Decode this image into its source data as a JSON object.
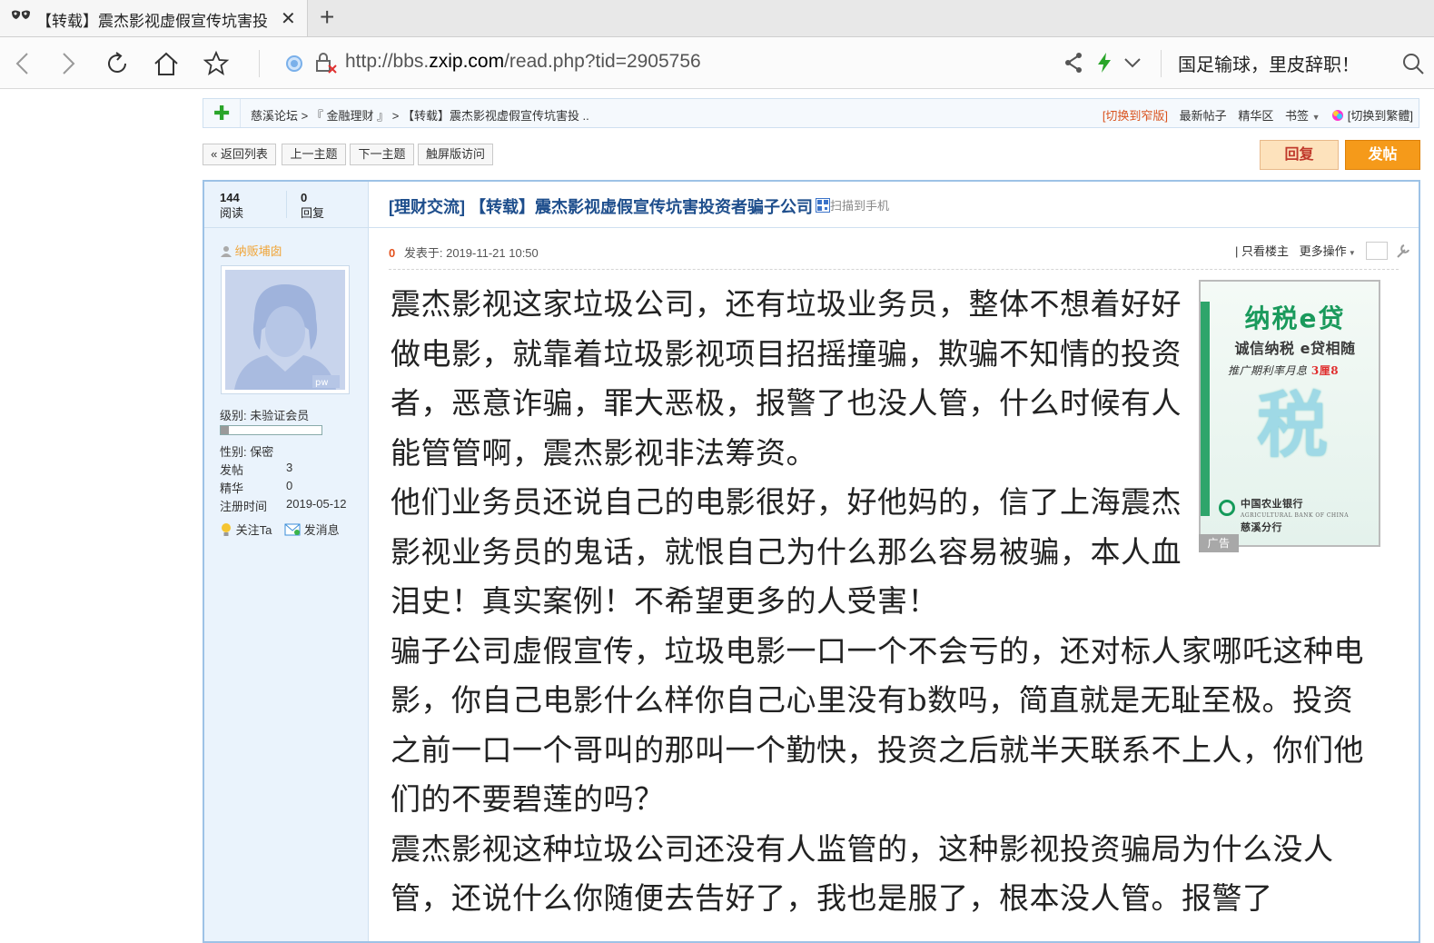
{
  "browser": {
    "tab_title": "【转载】震杰影视虚假宣传坑害投",
    "url_prefix": "http://bbs.",
    "url_domain": "zxip.com",
    "url_path": "/read.php?tid=2905756",
    "news_ticker": "国足输球，里皮辞职！"
  },
  "breadcrumb": {
    "forum": "慈溪论坛",
    "section": "『 金融理财 』",
    "thread": "【转载】震杰影视虚假宣传坑害投 ..",
    "right_links": {
      "narrow": "[切换到窄版]",
      "latest": "最新帖子",
      "digest": "精华区",
      "bookmark": "书签",
      "traditional": "[切换到繁體]"
    }
  },
  "buttons": {
    "back_list": "« 返回列表",
    "prev_topic": "上一主题",
    "next_topic": "下一主题",
    "touch": "触屏版访问",
    "reply": "回复",
    "post": "发帖"
  },
  "thread": {
    "views": "144",
    "views_label": "阅读",
    "replies": "0",
    "replies_label": "回复",
    "category": "[理财交流]",
    "title": "【转载】震杰影视虚假宣传坑害投资者骗子公司",
    "qr_label": "扫描到手机"
  },
  "user": {
    "name": "纳贩埔囱",
    "level_label": "级别: 未验证会员",
    "level_progress": 0.08,
    "gender_label": "性别: 保密",
    "posts_label": "发帖",
    "posts": "3",
    "digest_label": "精华",
    "digest": "0",
    "reg_label": "注册时间",
    "reg_date": "2019-05-12",
    "follow": "关注Ta",
    "message": "发消息"
  },
  "post": {
    "floor": "0",
    "posted_at": "发表于: 2019-11-21 10:50",
    "only_author": "| 只看楼主",
    "more_ops": "更多操作",
    "paragraphs": [
      "震杰影视这家垃圾公司，还有垃圾业务员，整体不想着好好做电影，就靠着垃圾影视项目招摇撞骗，欺骗不知情的投资者，恶意诈骗，罪大恶极，报警了也没人管，什么时候有人能管管啊，震杰影视非法筹资。",
      "他们业务员还说自己的电影很好，好他妈的，信了上海震杰影视业务员的鬼话，就恨自己为什么那么容易被骗，本人血泪史！真实案例！不希望更多的人受害！",
      "骗子公司虚假宣传，垃圾电影一口一个不会亏的，还对标人家哪吒这种电影，你自己电影什么样你自己心里没有b数吗，简直就是无耻至极。投资之前一口一个哥叫的那叫一个勤快，投资之后就半天联系不上人，你们他们的不要碧莲的吗？",
      "震杰影视这种垃圾公司还没有人监管的，这种影视投资骗局为什么没人管，还说什么你随便去告好了，我也是服了，根本没人管。报警了"
    ]
  },
  "ad": {
    "title": "纳税e贷",
    "subtitle": "诚信纳税 e贷相随",
    "promo_pre": "推广期利率月息",
    "promo_rate": "3厘8",
    "big_char": "税",
    "bank_cn": "中国农业银行",
    "bank_en": "AGRICULTURAL BANK OF CHINA",
    "branch": "慈溪分行",
    "tag": "广告"
  }
}
